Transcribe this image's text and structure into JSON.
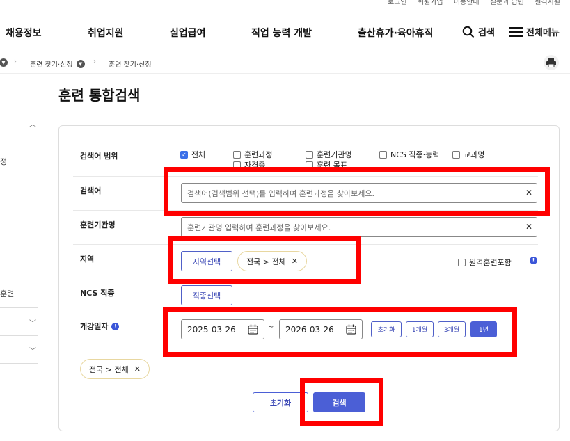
{
  "utility": [
    "로그인",
    "회원가입",
    "이용안내",
    "질문과 답변",
    "원격지원"
  ],
  "gnb": {
    "menus": [
      "채용정보",
      "취업지원",
      "실업급여",
      "직업 능력 개발",
      "출산휴가·육아휴직"
    ],
    "search_label": "검색",
    "all_menu_label": "전체메뉴"
  },
  "breadcrumb": [
    "훈련 찾기·신청",
    "훈련 찾기·신청"
  ],
  "side": {
    "item_label": "훈련",
    "partial_label": "정"
  },
  "page_title": "훈련 통합검색",
  "form": {
    "scope": {
      "label": "검색어 범위",
      "options": [
        "전체",
        "훈련과정",
        "훈련기관명",
        "NCS 직종·능력",
        "교과명",
        "자격증",
        "훈련 목표"
      ],
      "checked": [
        true,
        false,
        false,
        false,
        false,
        false,
        false
      ]
    },
    "keyword": {
      "label": "검색어",
      "placeholder": "검색어(검색범위 선택)를 입력하여 훈련과정을 찾아보세요."
    },
    "institution": {
      "label": "훈련기관명",
      "placeholder": "훈련기관명 입력하여 훈련과정을 찾아보세요."
    },
    "region": {
      "label": "지역",
      "button": "지역선택",
      "chip": "전국 > 전체",
      "remote_label": "원격훈련포함"
    },
    "ncs": {
      "label": "NCS 직종",
      "button": "직종선택"
    },
    "date": {
      "label": "개강일자",
      "start": "2025-03-26",
      "separator": "~",
      "end": "2026-03-26",
      "presets": [
        "초기화",
        "1개월",
        "3개월",
        "1년"
      ],
      "active_preset": "1년"
    },
    "selected_chip": "전국 > 전체"
  },
  "actions": {
    "reset": "초기화",
    "search": "검색"
  },
  "colors": {
    "primary": "#4b5fd6",
    "highlight": "#ff0000"
  },
  "icons": [
    "search-icon",
    "hamburger-icon",
    "printer-icon",
    "calendar-icon",
    "info-icon",
    "close-icon",
    "chevron-down-icon",
    "chevron-up-icon"
  ]
}
